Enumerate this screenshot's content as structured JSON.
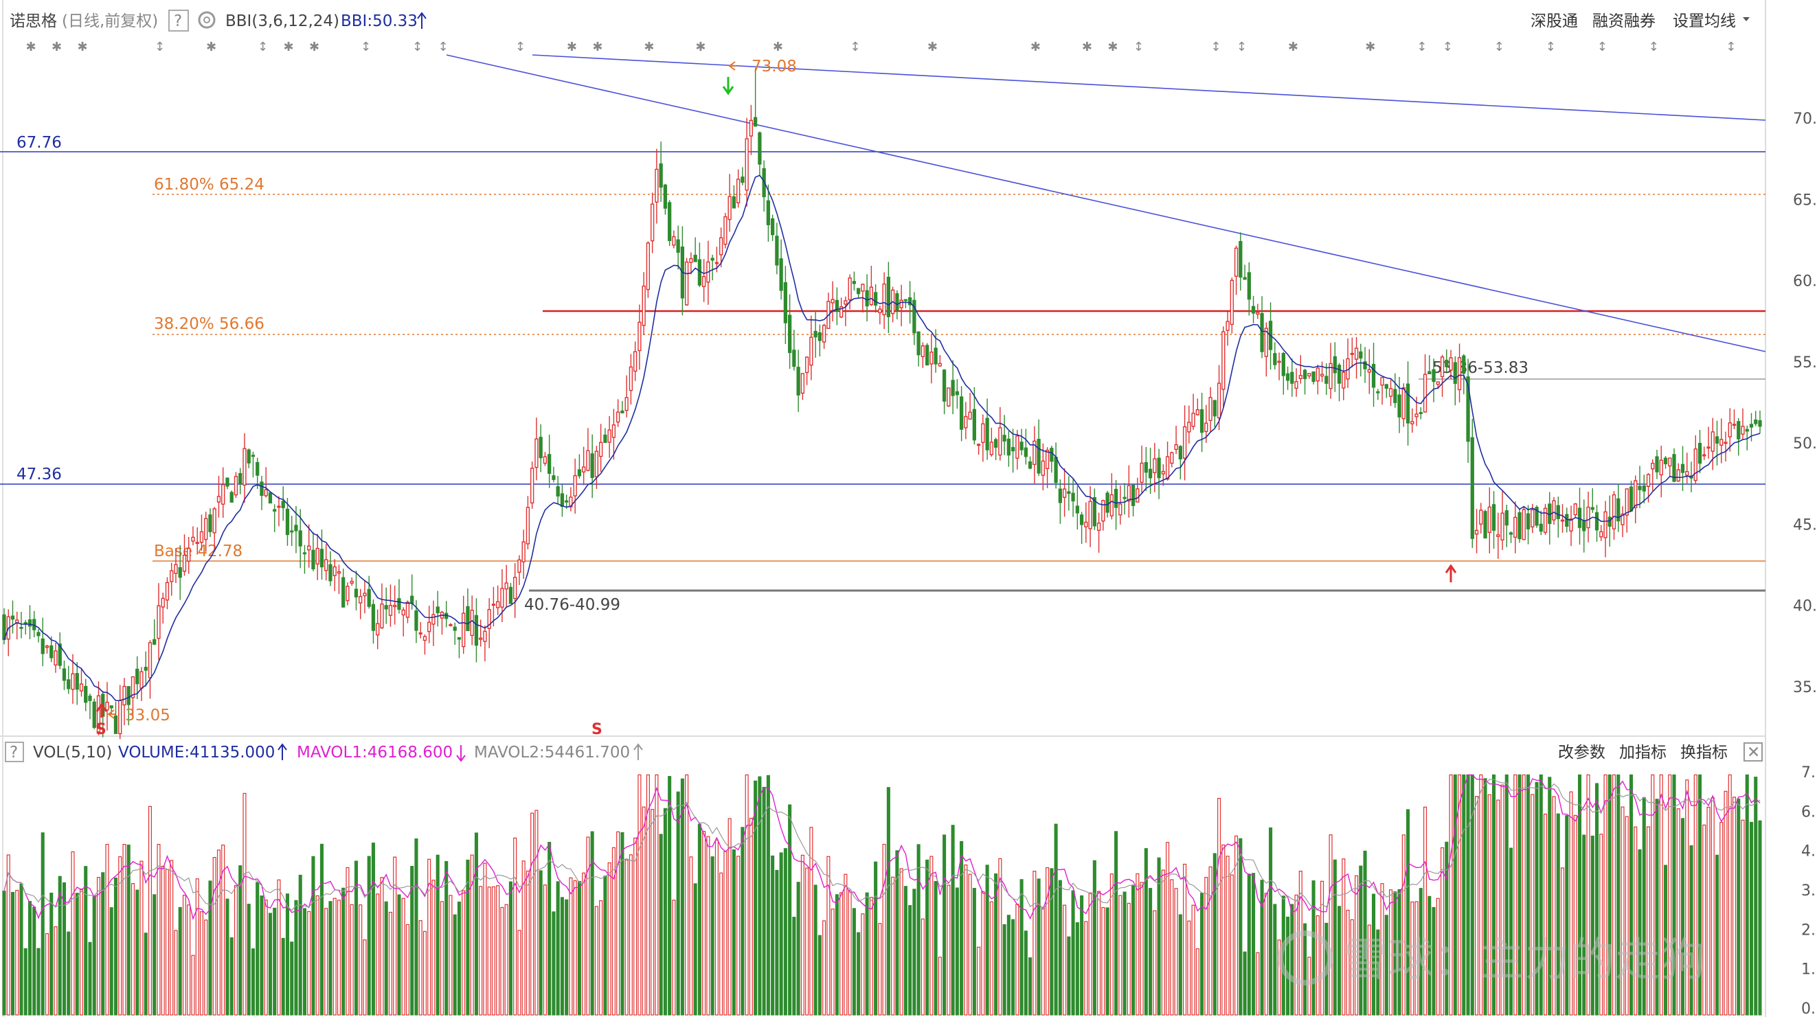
{
  "header": {
    "stock_name": "诺思格",
    "mode": "(日线,前复权)",
    "help": "?",
    "indicator": "BBI(3,6,12,24)",
    "indicator_value": "BBI:50.33",
    "menu_sz": "深股通",
    "menu_margin": "融资融券",
    "menu_ma": "设置均线"
  },
  "vol_header": {
    "help": "?",
    "label": "VOL(5,10)",
    "volume": "VOLUME:41135.000",
    "mavol1": "MAVOL1:46168.600",
    "mavol2": "MAVOL2:54461.700",
    "btn_params": "改参数",
    "btn_add": "加指标",
    "btn_switch": "换指标",
    "close": "✕"
  },
  "levels": {
    "line_67": "67.76",
    "line_47": "47.36",
    "fib_618": "61.80% 65.24",
    "fib_382": "38.20% 56.66",
    "fib_base": "Base 42.78",
    "range_low": "40.76-40.99",
    "range_high": "53.86-53.83",
    "high": "73.08",
    "low": "33.05",
    "signal_s": "S"
  },
  "watermark": "雪球：主力的走狗",
  "colors": {
    "up": "#e03030",
    "down": "#2e8b2e",
    "bbi": "#1f2ea0",
    "trend": "#4a50d8",
    "fib": "#e07830",
    "mavol1": "#e020d0",
    "mavol2": "#999999"
  },
  "chart_data": {
    "type": "candlestick",
    "price_axis": {
      "ticks": [
        70,
        65,
        60,
        55,
        50,
        45,
        40,
        35
      ],
      "tick_labels": [
        "70.",
        "65.",
        "60.",
        "55.",
        "50.",
        "45.",
        "40.",
        "35."
      ]
    },
    "volume_axis": {
      "tick_labels": [
        "7.",
        "6.",
        "4.",
        "3.",
        "2.",
        "1.",
        "0."
      ]
    },
    "key_levels": [
      67.76,
      65.24,
      58.3,
      56.66,
      53.85,
      47.36,
      42.78,
      40.88
    ],
    "extremes": {
      "high": 73.08,
      "low": 33.05
    },
    "waypoints": [
      [
        0,
        39.0
      ],
      [
        10,
        37.0
      ],
      [
        20,
        33.5
      ],
      [
        26,
        33.05
      ],
      [
        33,
        37.0
      ],
      [
        40,
        42.0
      ],
      [
        50,
        46.0
      ],
      [
        57,
        49.0
      ],
      [
        65,
        45.0
      ],
      [
        75,
        42.0
      ],
      [
        85,
        39.5
      ],
      [
        100,
        39.0
      ],
      [
        112,
        38.5
      ],
      [
        120,
        42.0
      ],
      [
        124,
        50.0
      ],
      [
        130,
        47.0
      ],
      [
        138,
        49.0
      ],
      [
        145,
        52.0
      ],
      [
        152,
        67.0
      ],
      [
        158,
        60.0
      ],
      [
        165,
        61.0
      ],
      [
        172,
        67.0
      ],
      [
        175,
        70.0
      ],
      [
        178,
        64.0
      ],
      [
        185,
        53.0
      ],
      [
        192,
        59.0
      ],
      [
        200,
        59.5
      ],
      [
        210,
        58.0
      ],
      [
        222,
        52.0
      ],
      [
        232,
        50.0
      ],
      [
        242,
        49.0
      ],
      [
        250,
        45.5
      ],
      [
        262,
        47.0
      ],
      [
        272,
        49.5
      ],
      [
        282,
        52.0
      ],
      [
        287,
        62.0
      ],
      [
        292,
        57.0
      ],
      [
        300,
        53.0
      ],
      [
        315,
        55.0
      ],
      [
        328,
        52.0
      ],
      [
        335,
        55.0
      ],
      [
        340,
        54.0
      ],
      [
        342,
        45.0
      ],
      [
        352,
        45.0
      ],
      [
        362,
        46.0
      ],
      [
        372,
        45.0
      ],
      [
        382,
        47.5
      ],
      [
        392,
        48.5
      ],
      [
        402,
        51.0
      ],
      [
        409,
        50.33
      ]
    ],
    "markers": [
      {
        "label": "73.08",
        "value": 73.08
      },
      {
        "label": "33.05",
        "value": 33.05
      }
    ]
  }
}
